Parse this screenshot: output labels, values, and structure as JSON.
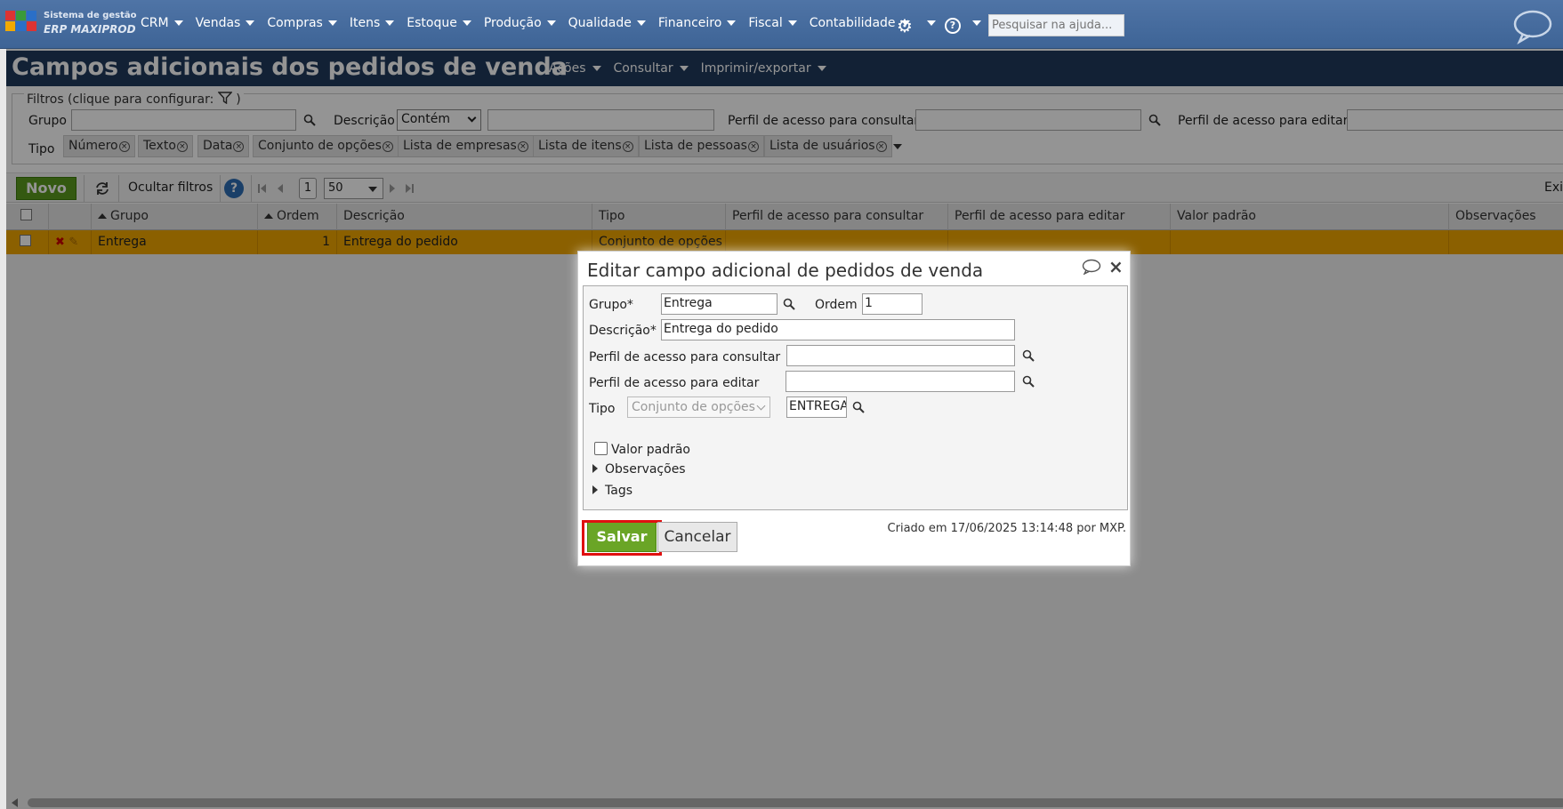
{
  "app": {
    "logo_line1": "Sistema de gestão",
    "logo_line2": "ERP MAXIPROD"
  },
  "menu": [
    "CRM",
    "Vendas",
    "Compras",
    "Itens",
    "Estoque",
    "Produção",
    "Qualidade",
    "Financeiro",
    "Fiscal",
    "Contabilidade"
  ],
  "top_search": {
    "placeholder": "Pesquisar na ajuda..."
  },
  "page": {
    "title": "Campos adicionais dos pedidos de venda",
    "title_menu": [
      "Ações",
      "Consultar",
      "Imprimir/exportar"
    ]
  },
  "filters": {
    "legend": "Filtros (clique para configurar:",
    "legend_end": ")",
    "grupo_label": "Grupo",
    "descricao_label": "Descrição",
    "descricao_operator": "Contém",
    "perfil_consultar_label": "Perfil de acesso para consultar",
    "perfil_editar_label": "Perfil de acesso para editar",
    "tipo_label": "Tipo",
    "tipo_chips": [
      "Número",
      "Texto",
      "Data",
      "Conjunto de opções",
      "Lista de empresas",
      "Lista de itens",
      "Lista de pessoas",
      "Lista de usuários"
    ]
  },
  "toolbar": {
    "novo": "Novo",
    "ocultar_filtros": "Ocultar filtros",
    "help": "?",
    "page_number": "1",
    "page_size": "50",
    "right_text": "Exi"
  },
  "grid": {
    "headers": [
      "Grupo",
      "Ordem",
      "Descrição",
      "Tipo",
      "Perfil de acesso para consultar",
      "Perfil de acesso para editar",
      "Valor padrão",
      "Observações"
    ],
    "row": {
      "grupo": "Entrega",
      "ordem": "1",
      "descricao": "Entrega do pedido",
      "tipo": "Conjunto de opções"
    }
  },
  "dialog": {
    "title": "Editar campo adicional de pedidos de venda",
    "grupo_label": "Grupo*",
    "grupo_value": "Entrega",
    "ordem_label": "Ordem",
    "ordem_value": "1",
    "descricao_label": "Descrição*",
    "descricao_value": "Entrega do pedido",
    "perfil_consultar_label": "Perfil de acesso para consultar",
    "perfil_editar_label": "Perfil de acesso para editar",
    "tipo_label": "Tipo",
    "tipo_value": "Conjunto de opções",
    "tipo_code": "ENTREGA",
    "valor_padrao_label": "Valor padrão",
    "observacoes_label": "Observações",
    "tags_label": "Tags",
    "save": "Salvar",
    "cancel": "Cancelar",
    "created_text": "Criado em 17/06/2025 13:14:48 por MXP."
  },
  "colors": {
    "topbar": "#4f74a6",
    "titlebar": "#1f3a5c",
    "row_selected": "#f0a500",
    "save_green": "#6aa526",
    "highlight_red": "#e01010"
  }
}
